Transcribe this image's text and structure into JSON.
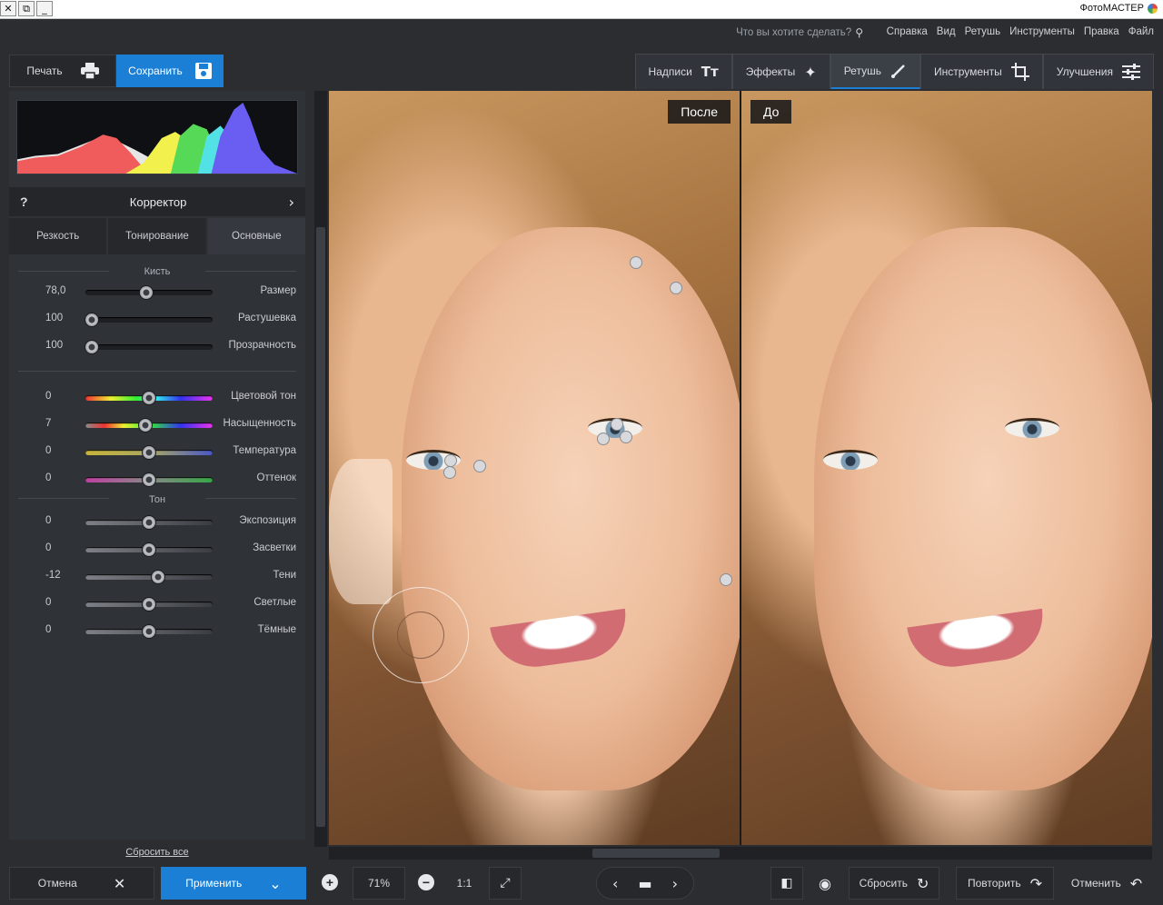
{
  "window": {
    "title": "ФотоМАСТЕР",
    "controls": [
      "✕",
      "⧉",
      "_"
    ]
  },
  "menu": {
    "items": [
      "Справка",
      "Вид",
      "Ретушь",
      "Инструменты",
      "Правка",
      "Файл"
    ],
    "search_placeholder": "Что вы хотите сделать?"
  },
  "toolbar": {
    "print_label": "Печать",
    "save_label": "Сохранить",
    "tabs": [
      {
        "label": "Надписи",
        "icon": "text-icon"
      },
      {
        "label": "Эффекты",
        "icon": "magic-wand-icon"
      },
      {
        "label": "Ретушь",
        "icon": "brush-icon",
        "active": true
      },
      {
        "label": "Инструменты",
        "icon": "crop-icon"
      },
      {
        "label": "Улучшения",
        "icon": "sliders-icon"
      }
    ]
  },
  "panel": {
    "title": "Корректор",
    "help": "?",
    "subtabs": [
      "Резкость",
      "Тонирование",
      "Основные"
    ],
    "sections": {
      "brush": "Кисть",
      "tone": "Тон"
    },
    "brush": [
      {
        "label": "Размер",
        "value": "78,0",
        "level": 0.48
      },
      {
        "label": "Растушевка",
        "value": "100",
        "level": 0.05
      },
      {
        "label": "Прозрачность",
        "value": "100",
        "level": 0.05
      }
    ],
    "color": [
      {
        "label": "Цветовой тон",
        "value": "0",
        "level": 0.5,
        "style": "hue"
      },
      {
        "label": "Насыщенность",
        "value": "7",
        "level": 0.47,
        "style": "sat"
      },
      {
        "label": "Температура",
        "value": "0",
        "level": 0.5,
        "style": "temp"
      },
      {
        "label": "Оттенок",
        "value": "0",
        "level": 0.5,
        "style": "tint"
      }
    ],
    "tone": [
      {
        "label": "Экспозиция",
        "value": "0",
        "level": 0.5
      },
      {
        "label": "Засветки",
        "value": "0",
        "level": 0.5
      },
      {
        "label": "Тени",
        "value": "-12",
        "level": 0.57
      },
      {
        "label": "Светлые",
        "value": "0",
        "level": 0.5
      },
      {
        "label": "Тёмные",
        "value": "0",
        "level": 0.5
      }
    ],
    "reset_all": "Сбросить все"
  },
  "canvas": {
    "after_label": "После",
    "before_label": "До"
  },
  "bottom": {
    "cancel_label": "Отмена",
    "apply_label": "Применить",
    "zoom_value": "71%",
    "zoom_one_to_one": "1:1",
    "reset_label": "Сбросить",
    "redo_label": "Повторить",
    "undo_label": "Отменить"
  },
  "colors": {
    "accent": "#1c7fd6",
    "background": "#2b2d31",
    "panel": "#2f3237"
  }
}
